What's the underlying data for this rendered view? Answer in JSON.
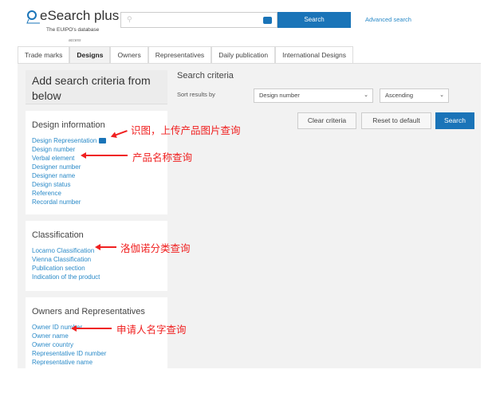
{
  "header": {
    "logo": "eSearch plus",
    "subtitle": "The EUIPO's database",
    "subtitle2": "access",
    "search_placeholder": "",
    "search_label": "Search",
    "advanced": "Advanced search"
  },
  "tabs": [
    "Trade marks",
    "Designs",
    "Owners",
    "Representatives",
    "Daily publication",
    "International Designs"
  ],
  "left": {
    "title": "Add search criteria from below",
    "sections": [
      {
        "title": "Design information",
        "links": [
          "Design Representation",
          "Design number",
          "Verbal element",
          "Designer number",
          "Designer name",
          "Design status",
          "Reference",
          "Recordal number"
        ]
      },
      {
        "title": "Classification",
        "links": [
          "Locarno Classification",
          "Vienna Classification",
          "Publication section",
          "Indication of the product"
        ]
      },
      {
        "title": "Owners and Representatives",
        "links": [
          "Owner ID number",
          "Owner name",
          "Owner country",
          "Representative ID number",
          "Representative name"
        ]
      }
    ]
  },
  "criteria": {
    "title": "Search criteria",
    "sort_label": "Sort results by",
    "sort_field": "Design number",
    "sort_order": "Ascending",
    "clear": "Clear criteria",
    "reset": "Reset to default",
    "search": "Search"
  },
  "annotations": [
    "识图，上传产品图片查询",
    "产品名称查询",
    "洛伽诺分类查询",
    "申请人名字查询"
  ]
}
